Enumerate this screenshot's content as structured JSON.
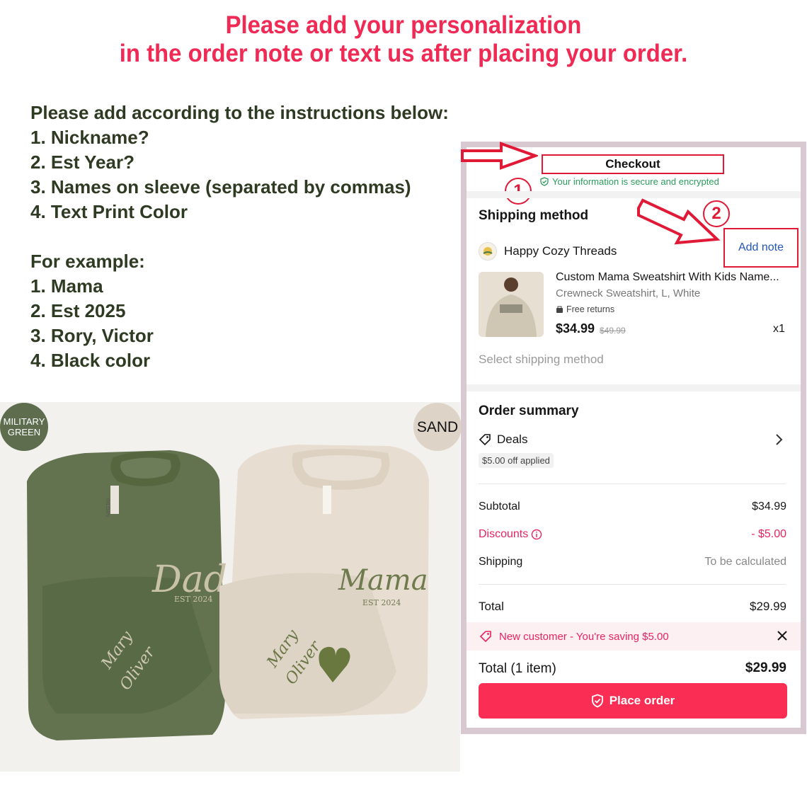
{
  "headline": {
    "line1": "Please add your personalization",
    "line2": "in the order note or text us after placing your order."
  },
  "instructions": {
    "intro": "Please add according to the instructions below:",
    "steps": [
      "1. Nickname?",
      "2. Est Year?",
      "3. Names on sleeve (separated by commas)",
      "4. Text Print Color"
    ],
    "example_title": "For example:",
    "examples": [
      "1. Mama",
      "2. Est 2025",
      "3. Rory, Victor",
      "4. Black color"
    ]
  },
  "swatches": {
    "green_label_1": "MILITARY",
    "green_label_2": "GREEN",
    "sand_label": "SAND"
  },
  "sweatshirts": {
    "left_word": "Dad",
    "left_est": "EST 2024",
    "left_sleeve_1": "Mary",
    "left_sleeve_2": "Oliver",
    "right_word": "Mama",
    "right_est": "EST 2024",
    "right_sleeve_1": "Mary",
    "right_sleeve_2": "Oliver",
    "tag": "GILDAN"
  },
  "checkout": {
    "title": "Checkout",
    "secure": "Your information is secure and encrypted",
    "step1": "1",
    "step2": "2",
    "shipping_method": "Shipping method",
    "shop_name": "Happy Cozy Threads",
    "add_note": "Add note",
    "product_title": "Custom Mama Sweatshirt With Kids Name...",
    "product_variant": "Crewneck Sweatshirt, L, White",
    "free_returns": "Free returns",
    "price": "$34.99",
    "old_price": "$49.99",
    "quantity": "x1",
    "select_shipping": "Select shipping method",
    "order_summary": "Order summary",
    "deals": "Deals",
    "deal_applied": "$5.00 off applied",
    "subtotal_label": "Subtotal",
    "subtotal_value": "$34.99",
    "discounts_label": "Discounts",
    "discounts_value": "- $5.00",
    "shipping_label": "Shipping",
    "shipping_value": "To be calculated",
    "total_label": "Total",
    "total_value": "$29.99",
    "promo": "New customer - You're saving $5.00",
    "total_items_label": "Total",
    "total_items_count": "(1 item)",
    "total_items_value": "$29.99",
    "place_order": "Place order",
    "accent_color": "#fa2d55",
    "annotation_color": "#e01936"
  }
}
